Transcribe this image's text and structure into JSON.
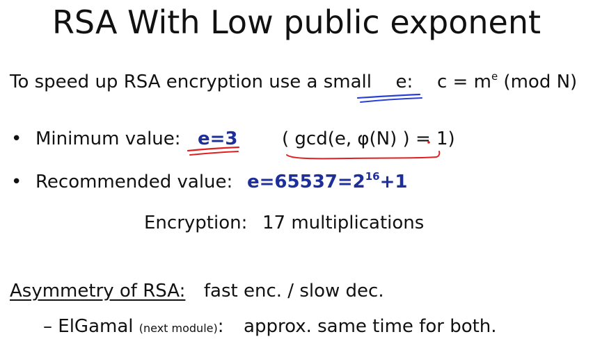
{
  "title": "RSA With Low public exponent",
  "intro": {
    "text": "To speed up RSA encryption use a small",
    "e_label": "e:",
    "formula_prefix": "c = m",
    "formula_sup": "e",
    "formula_suffix": " (mod N)"
  },
  "bullets": [
    {
      "marker": "•",
      "label": "Minimum value:",
      "value": "e=3",
      "note": "( gcd(e, φ(N) ) = 1)"
    },
    {
      "marker": "•",
      "label": "Recommended value:",
      "value_prefix": "e=65537=2",
      "value_sup": "16",
      "value_suffix": "+1"
    }
  ],
  "encryption": {
    "label": "Encryption:",
    "value": "17 multiplications"
  },
  "asymmetry": {
    "label": "Asymmetry of RSA:",
    "text": "fast enc. / slow dec."
  },
  "elgamal": {
    "dash": "–",
    "name": "ElGamal",
    "paren": "(next module)",
    "colon": ":",
    "text": "approx. same time for both."
  },
  "colors": {
    "accent_blue": "#1f2f99",
    "pen_blue": "#2a3fd6",
    "pen_red": "#e02020",
    "text": "#111111"
  }
}
